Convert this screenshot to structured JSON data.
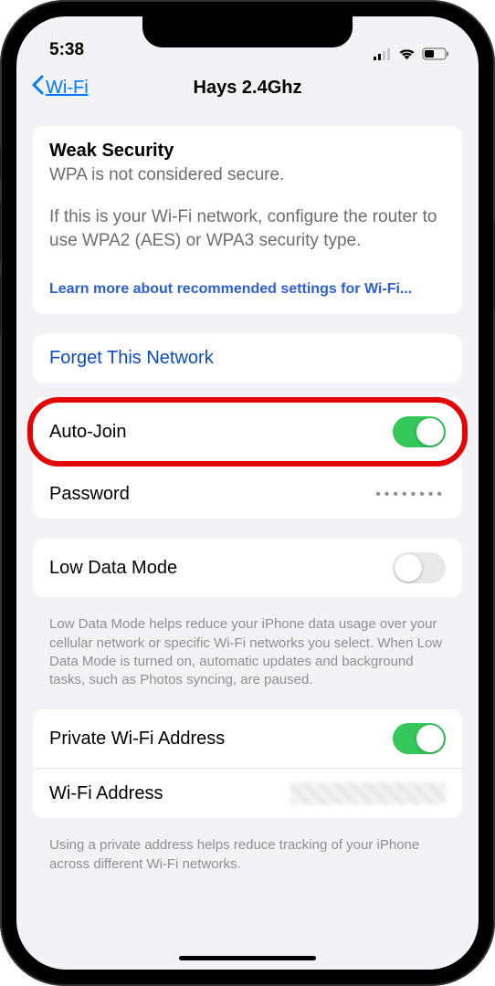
{
  "status": {
    "time": "5:38"
  },
  "nav": {
    "back_label": "Wi-Fi",
    "title": "Hays 2.4Ghz"
  },
  "weak_security": {
    "title": "Weak Security",
    "subtitle": "WPA is not considered secure.",
    "body": "If this is your Wi-Fi network, configure the router to use WPA2 (AES) or WPA3 security type.",
    "link": "Learn more about recommended settings for Wi-Fi..."
  },
  "forget": {
    "label": "Forget This Network"
  },
  "auto_join": {
    "label": "Auto-Join",
    "on": true
  },
  "password": {
    "label": "Password",
    "masked": "••••••••"
  },
  "low_data": {
    "label": "Low Data Mode",
    "on": false,
    "footer": "Low Data Mode helps reduce your iPhone data usage over your cellular network or specific Wi-Fi networks you select. When Low Data Mode is turned on, automatic updates and background tasks, such as Photos syncing, are paused."
  },
  "private_addr": {
    "label": "Private Wi-Fi Address",
    "on": true
  },
  "wifi_addr": {
    "label": "Wi-Fi Address"
  },
  "private_footer": "Using a private address helps reduce tracking of your iPhone across different Wi-Fi networks."
}
